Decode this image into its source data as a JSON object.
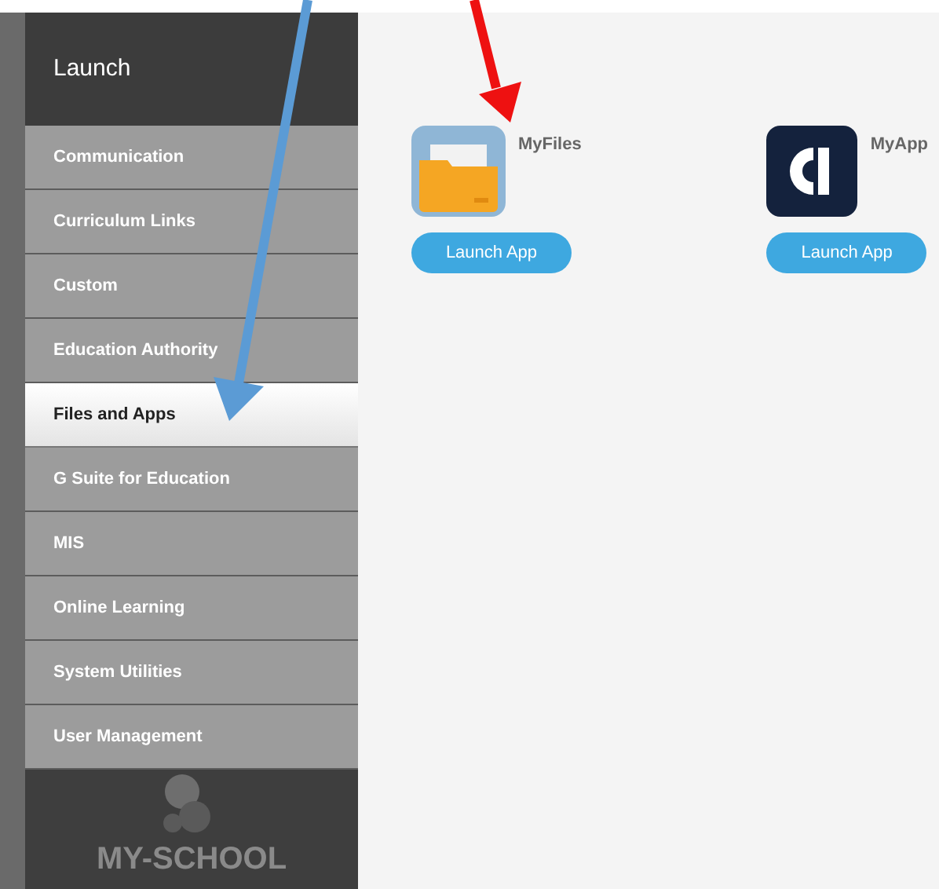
{
  "sidebar": {
    "title": "Launch",
    "items": [
      {
        "label": "Communication",
        "selected": false
      },
      {
        "label": "Curriculum Links",
        "selected": false
      },
      {
        "label": "Custom",
        "selected": false
      },
      {
        "label": "Education Authority",
        "selected": false
      },
      {
        "label": "Files and Apps",
        "selected": true
      },
      {
        "label": "G Suite for Education",
        "selected": false
      },
      {
        "label": "MIS",
        "selected": false
      },
      {
        "label": "Online Learning",
        "selected": false
      },
      {
        "label": "System Utilities",
        "selected": false
      },
      {
        "label": "User Management",
        "selected": false
      }
    ],
    "logo": "MY-SCHOOL"
  },
  "apps": [
    {
      "name": "MyFiles",
      "kind": "folder",
      "button": "Launch App"
    },
    {
      "name": "MyApp",
      "kind": "ruler",
      "button": "Launch App"
    }
  ]
}
